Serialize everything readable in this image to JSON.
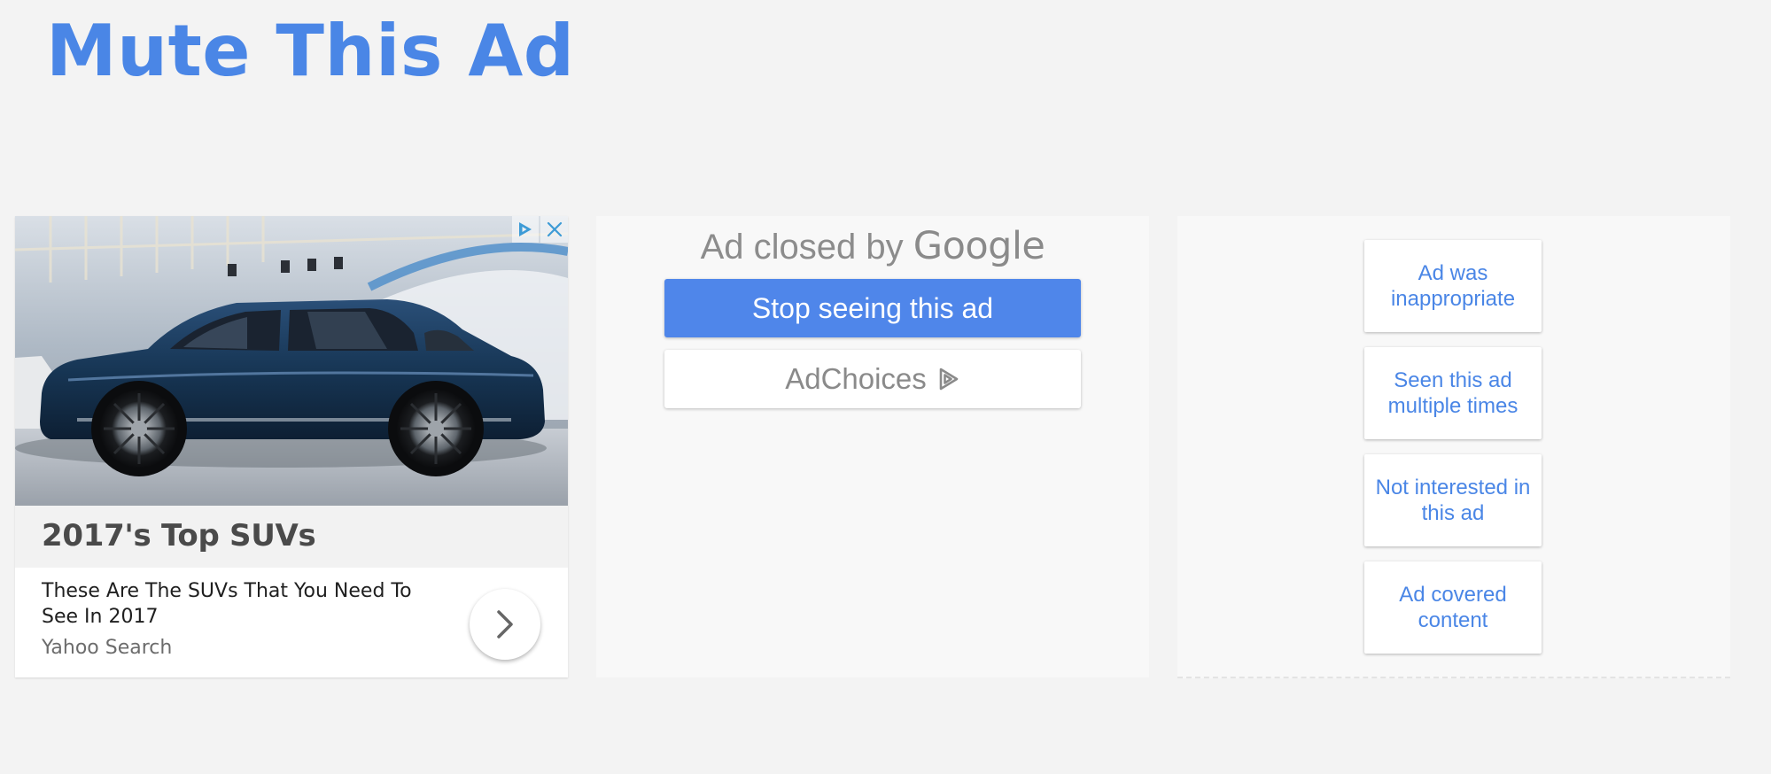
{
  "page": {
    "title": "Mute This Ad"
  },
  "ad": {
    "image_subject": "blue SUV at auto show",
    "headline": "2017's Top SUVs",
    "description": "These Are The SUVs That You Need To See In 2017",
    "source": "Yahoo Search",
    "icons": {
      "adchoices": "adchoices-triangle-icon",
      "close": "close-x-icon",
      "cta": "chevron-right-icon"
    }
  },
  "closed": {
    "heading_prefix": "Ad closed by",
    "brand": "Google",
    "stop_button_label": "Stop seeing this ad",
    "adchoices_label": "AdChoices",
    "adchoices_icon": "adchoices-triangle-icon"
  },
  "reasons": [
    {
      "label": "Ad was inappropriate"
    },
    {
      "label": "Seen this ad multiple times"
    },
    {
      "label": "Not interested in this ad"
    },
    {
      "label": "Ad covered content"
    }
  ],
  "colors": {
    "accent_blue": "#4a86e6",
    "button_blue": "#4f86ea",
    "page_background": "#f3f3f3",
    "panel_background": "#f8f8f8"
  }
}
